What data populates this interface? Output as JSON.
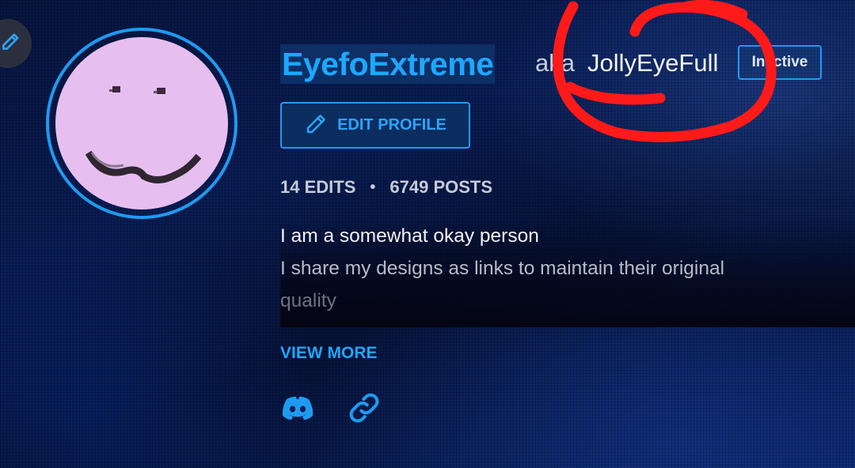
{
  "profile": {
    "username": "EyefoExtreme",
    "aka_label": "aka",
    "alt_name": "JollyEyeFull",
    "status": "Inactive",
    "edit_button_label": "EDIT PROFILE",
    "stats": {
      "edits": "14 EDITS",
      "separator": "•",
      "posts": "6749 POSTS"
    },
    "bio": [
      "I am a somewhat okay person",
      "I share my designs as links to maintain their original",
      "quality"
    ],
    "view_more_label": "VIEW MORE"
  },
  "icons": {
    "corner": "pencil-icon",
    "edit": "pencil-icon",
    "social_1": "discord-icon",
    "social_2": "link-icon"
  },
  "colors": {
    "accent": "#1e9bf0",
    "avatar_bg": "#e6bff0",
    "annotation": "#ff1a1a"
  }
}
